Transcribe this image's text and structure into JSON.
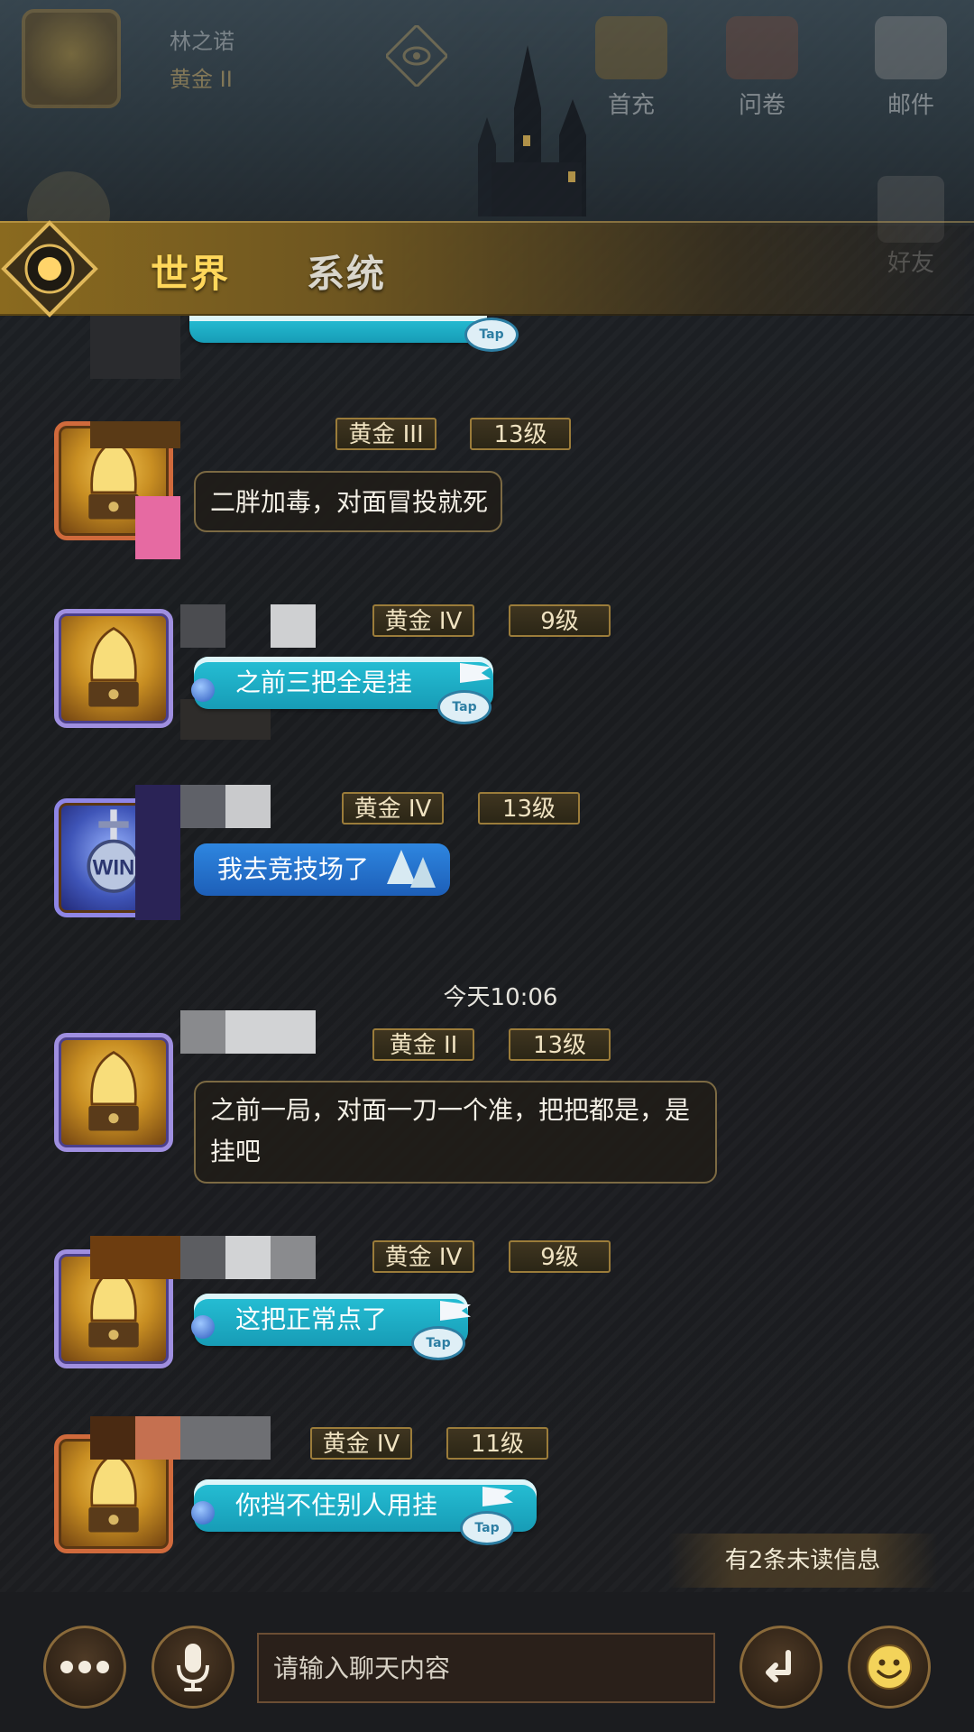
{
  "profile": {
    "name": "林之诺",
    "rank": "黄金 II"
  },
  "top_buttons": [
    {
      "label": "首充",
      "icon": "gift-icon"
    },
    {
      "label": "问卷",
      "icon": "survey-icon"
    },
    {
      "label": "邮件",
      "icon": "mail-icon"
    }
  ],
  "side_button": {
    "label": "好友",
    "icon": "friends-icon"
  },
  "tabs": {
    "world": "世界",
    "system": "系统"
  },
  "messages": [
    {
      "rank": "黄金 III",
      "level": "13级",
      "text": "二胖加毒，对面冒投就死",
      "style": "dark"
    },
    {
      "rank": "黄金 IV",
      "level": "9级",
      "text": "之前三把全是挂",
      "style": "cyan"
    },
    {
      "rank": "黄金 IV",
      "level": "13级",
      "text": "我去竞技场了",
      "style": "blue"
    },
    {
      "rank": "黄金 II",
      "level": "13级",
      "text": "之前一局，对面一刀一个准，把把都是，是挂吧",
      "style": "dark"
    },
    {
      "rank": "黄金 IV",
      "level": "9级",
      "text": "这把正常点了",
      "style": "cyan"
    },
    {
      "rank": "黄金 IV",
      "level": "11级",
      "text": "你挡不住别人用挂",
      "style": "cyan"
    }
  ],
  "timestamp": {
    "day": "今天",
    "time": "10:06"
  },
  "tap_label": "Tap",
  "unread": "有2条未读信息",
  "input": {
    "placeholder": "请输入聊天内容"
  },
  "bottom_buttons": {
    "more": "more-icon",
    "voice": "microphone-icon",
    "send": "send-icon",
    "emoji": "emoji-icon"
  },
  "colors": {
    "accent_gold": "#ffd75a",
    "bubble_cyan": "#26c0d6",
    "bubble_blue": "#2e86e0",
    "tag_border": "#9b7c3a"
  }
}
